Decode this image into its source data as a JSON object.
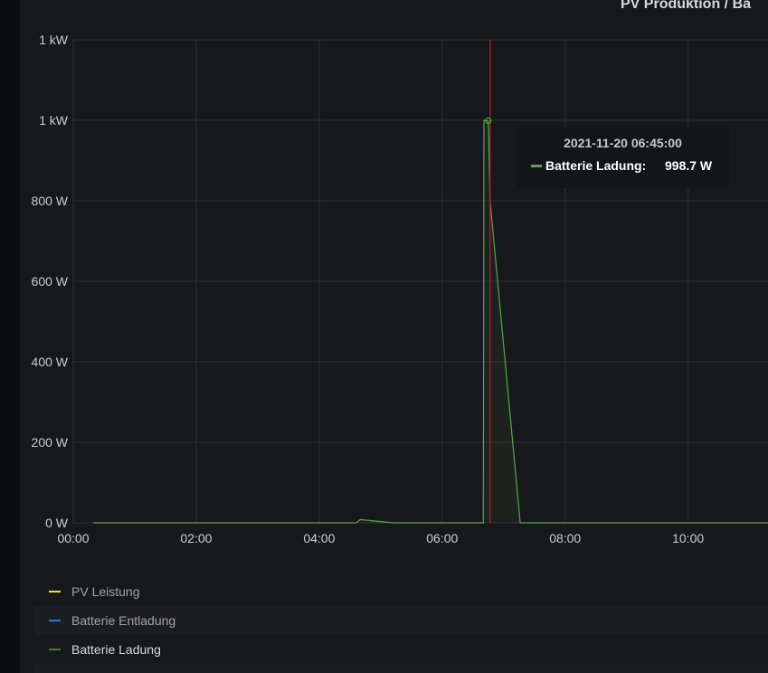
{
  "panel": {
    "title": "PV Produktion / Ba"
  },
  "chart_data": {
    "type": "line",
    "title": "PV Produktion / Ba",
    "xlabel": "",
    "ylabel": "",
    "x_unit": "hours since 00:00",
    "xlim": [
      0,
      11.3
    ],
    "ylim": [
      0,
      1200
    ],
    "x_ticks": [
      {
        "value": 0,
        "label": "00:00"
      },
      {
        "value": 2,
        "label": "02:00"
      },
      {
        "value": 4,
        "label": "04:00"
      },
      {
        "value": 6,
        "label": "06:00"
      },
      {
        "value": 8,
        "label": "08:00"
      },
      {
        "value": 10,
        "label": "10:00"
      }
    ],
    "y_ticks": [
      {
        "value": 0,
        "label": "0 W"
      },
      {
        "value": 200,
        "label": "200 W"
      },
      {
        "value": 400,
        "label": "400 W"
      },
      {
        "value": 600,
        "label": "600 W"
      },
      {
        "value": 800,
        "label": "800 W"
      },
      {
        "value": 1000,
        "label": "1 kW"
      },
      {
        "value": 1200,
        "label": "1 kW"
      }
    ],
    "grid": true,
    "series": [
      {
        "name": "PV Leistung",
        "color": "#fade2a",
        "x": [],
        "y": []
      },
      {
        "name": "Batterie Entladung",
        "color": "#5794f2",
        "x": [],
        "y": []
      },
      {
        "name": "Batterie Ladung",
        "color": "#56a64b",
        "x": [
          0.33,
          4.6,
          4.67,
          5.2,
          6.67,
          6.68,
          6.75,
          6.78,
          7.27,
          11.3
        ],
        "y": [
          0,
          0,
          8,
          0,
          0,
          1000,
          998.7,
          800,
          0,
          0
        ]
      }
    ],
    "cursor_x": 6.78,
    "tooltip": {
      "time": "2021-11-20 06:45:00",
      "series": "Batterie Ladung:",
      "value": "998.7 W"
    },
    "legend_placement": "bottom"
  }
}
